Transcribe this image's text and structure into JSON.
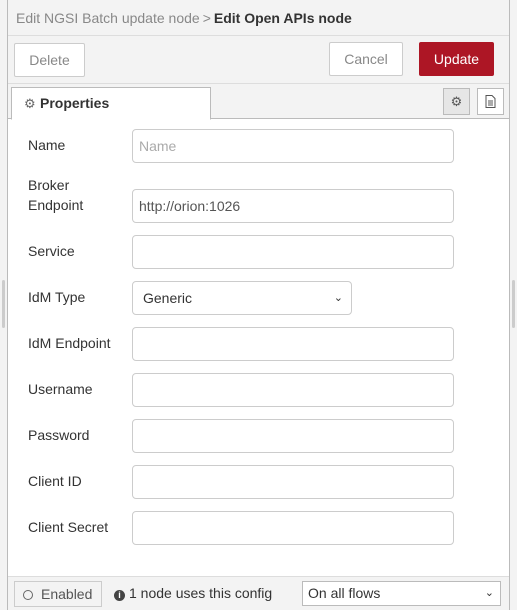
{
  "header": {
    "breadcrumb": "Edit NGSI Batch update node",
    "separator": ">",
    "title": "Edit Open APIs node"
  },
  "toolbar": {
    "delete_label": "Delete",
    "cancel_label": "Cancel",
    "update_label": "Update"
  },
  "tabs": {
    "properties_label": "Properties",
    "settings_icon": "gear-icon",
    "description_icon": "document-icon"
  },
  "form": {
    "name": {
      "label": "Name",
      "value": "",
      "placeholder": "Name"
    },
    "broker_endpoint": {
      "label_line1": "Broker",
      "label_line2": "Endpoint",
      "value": "http://orion:1026"
    },
    "service": {
      "label": "Service",
      "value": ""
    },
    "idm_type": {
      "label": "IdM Type",
      "selected": "Generic"
    },
    "idm_endpoint": {
      "label": "IdM Endpoint",
      "value": ""
    },
    "username": {
      "label": "Username",
      "value": ""
    },
    "password": {
      "label": "Password",
      "value": ""
    },
    "client_id": {
      "label": "Client ID",
      "value": ""
    },
    "client_secret": {
      "label": "Client Secret",
      "value": ""
    }
  },
  "footer": {
    "enabled_label": "Enabled",
    "usage_text": "1 node uses this config",
    "scope_selected": "On all flows"
  },
  "colors": {
    "update_button": "#ad1625"
  }
}
